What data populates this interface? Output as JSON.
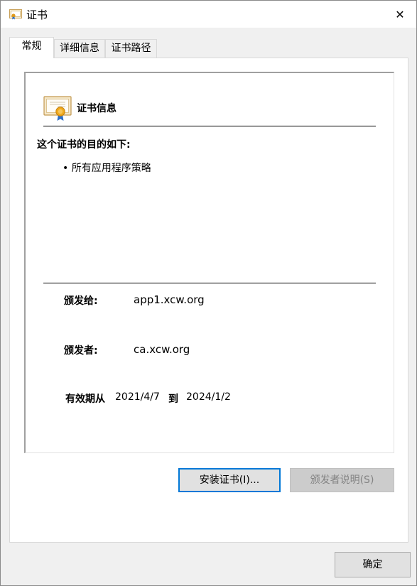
{
  "window": {
    "title": "证书",
    "close_glyph": "✕"
  },
  "tabs": [
    {
      "label": "常规",
      "active": true
    },
    {
      "label": "详细信息",
      "active": false
    },
    {
      "label": "证书路径",
      "active": false
    }
  ],
  "general": {
    "info_title": "证书信息",
    "purpose_heading": "这个证书的目的如下:",
    "purposes": [
      "• 所有应用程序策略"
    ],
    "issued_to_label": "颁发给:",
    "issued_to_value": "app1.xcw.org",
    "issued_by_label": "颁发者:",
    "issued_by_value": "ca.xcw.org",
    "valid_from_label": "有效期从",
    "valid_from": "2021/4/7",
    "valid_to_label": "到",
    "valid_to": "2024/1/2"
  },
  "buttons": {
    "install": "安装证书(I)...",
    "issuer_statement": "颁发者说明(S)",
    "ok": "确定"
  },
  "colors": {
    "focus_border": "#0078d7",
    "disabled_text": "#838383"
  }
}
